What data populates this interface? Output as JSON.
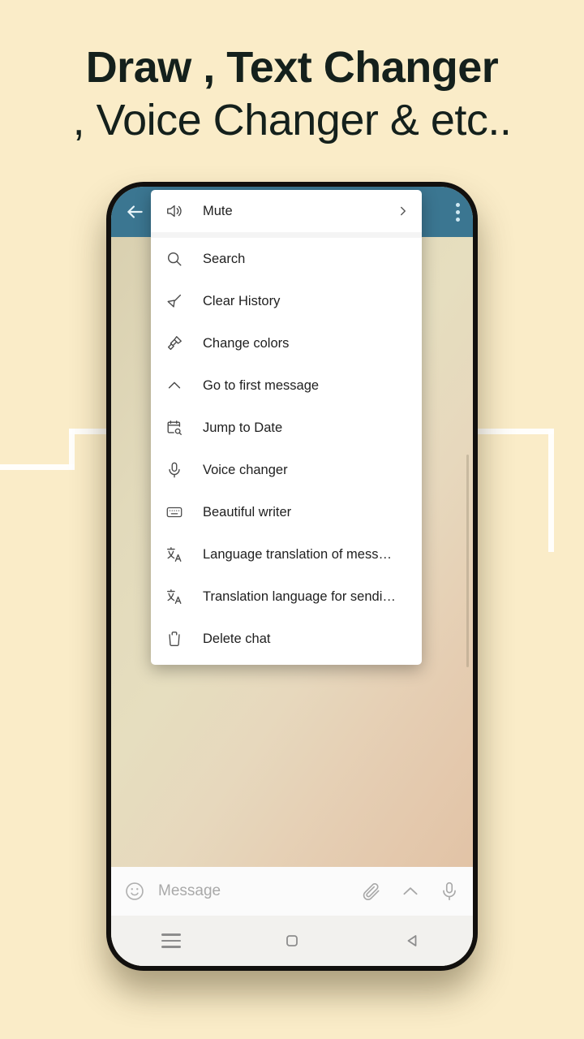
{
  "headline": {
    "line1": "Draw , Text Changer",
    "line2": ", Voice Changer & etc.."
  },
  "colors": {
    "page_background": "#faecc8",
    "app_bar": "#3b7691",
    "menu_background": "#ffffff",
    "deco_line": "#ffffff",
    "text_primary": "#1f1f1f",
    "headline_color": "#14201c"
  },
  "phone": {
    "topbar": {
      "back_icon": "arrow-left-icon",
      "overflow_icon": "kebab-menu-icon"
    },
    "menu": {
      "items": [
        {
          "label": "Mute",
          "icon": "speaker-mute-icon",
          "trailing": "chevron-right-icon"
        },
        {
          "label": "Search",
          "icon": "search-icon",
          "trailing": ""
        },
        {
          "label": "Clear History",
          "icon": "broom-icon",
          "trailing": ""
        },
        {
          "label": "Change colors",
          "icon": "paint-brush-icon",
          "trailing": ""
        },
        {
          "label": "Go to first message",
          "icon": "chevron-up-icon",
          "trailing": ""
        },
        {
          "label": "Jump to Date",
          "icon": "calendar-search-icon",
          "trailing": ""
        },
        {
          "label": "Voice changer",
          "icon": "microphone-icon",
          "trailing": ""
        },
        {
          "label": "Beautiful writer",
          "icon": "keyboard-icon",
          "trailing": ""
        },
        {
          "label": "Language translation of mess…",
          "icon": "translate-icon",
          "trailing": ""
        },
        {
          "label": "Translation language for sendi…",
          "icon": "translate-icon",
          "trailing": ""
        },
        {
          "label": "Delete chat",
          "icon": "trash-icon",
          "trailing": ""
        }
      ]
    },
    "message_bar": {
      "emoji_icon": "smiley-icon",
      "placeholder": "Message",
      "attach_icon": "paperclip-icon",
      "expand_icon": "chevron-up-icon",
      "mic_icon": "microphone-icon"
    },
    "nav_bar": {
      "recents_icon": "hamburger-recents-icon",
      "home_icon": "square-home-icon",
      "back_icon": "triangle-back-icon"
    }
  }
}
